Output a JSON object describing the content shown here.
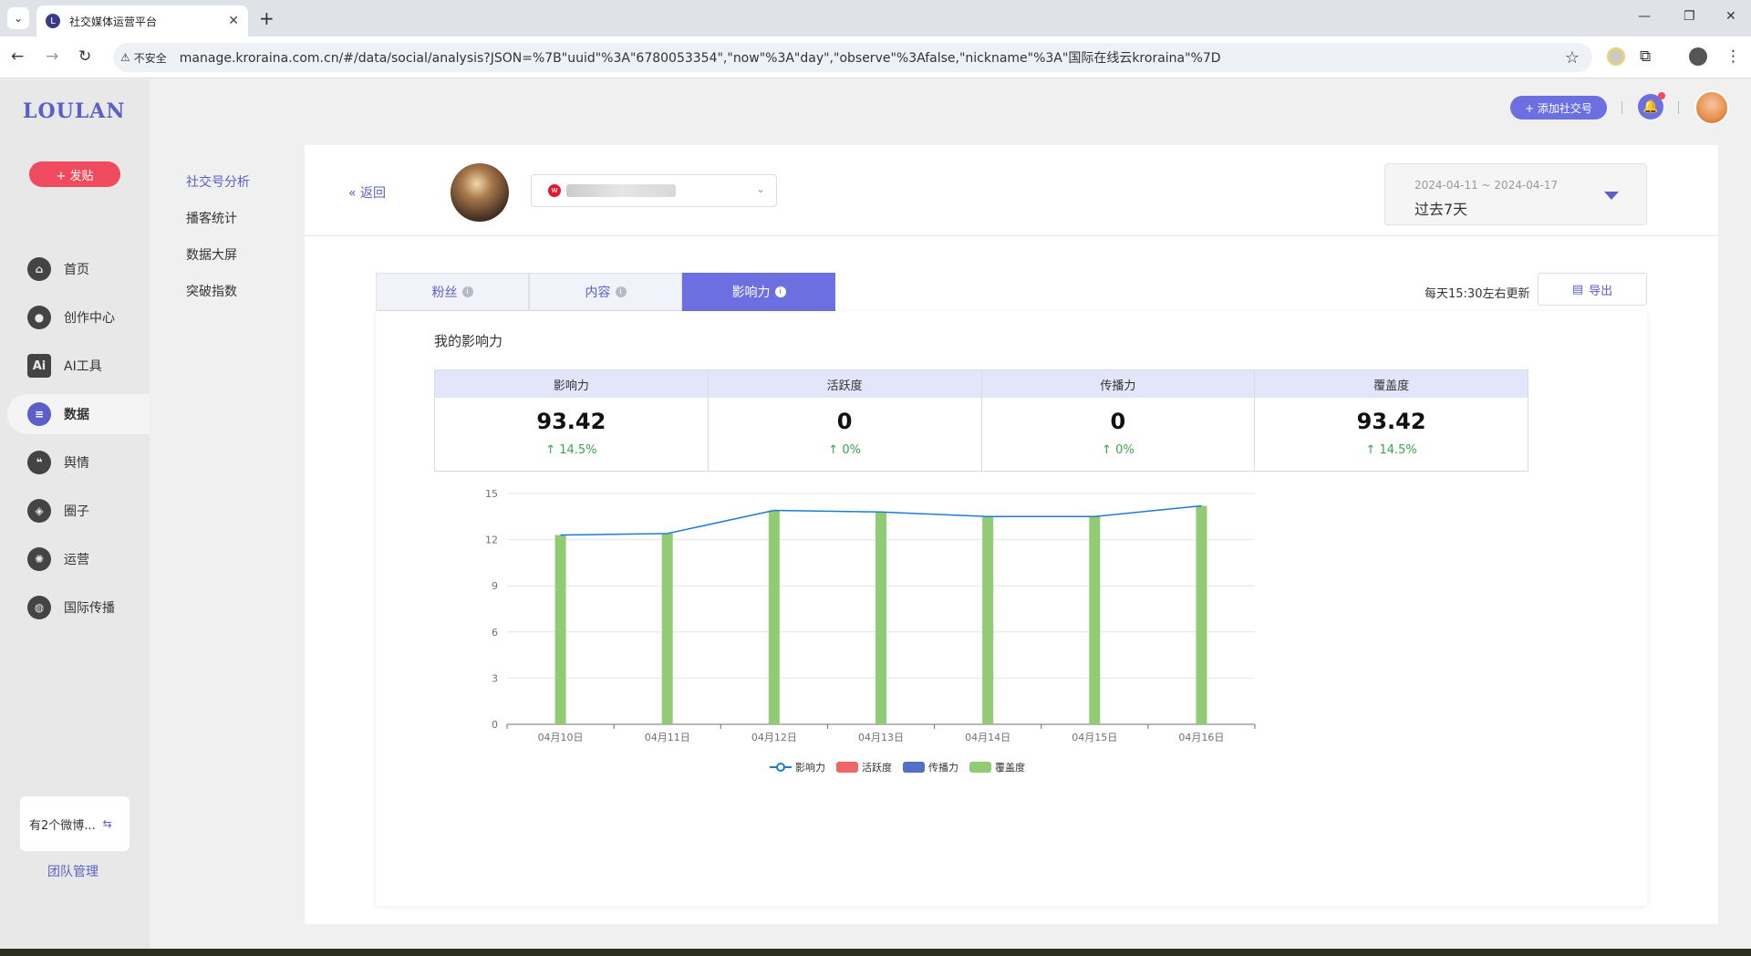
{
  "browser": {
    "tab_title": "社交媒体运营平台",
    "insecure_label": "不安全",
    "url": "manage.kroraina.com.cn/#/data/social/analysis?JSON=%7B\"uuid\"%3A\"6780053354\",\"now\"%3A\"day\",\"observe\"%3Afalse,\"nickname\"%3A\"国际在线云kroraina\"%7D"
  },
  "sidebar": {
    "logo": "LOULAN",
    "post_button": "+ 发贴",
    "items": [
      {
        "label": "首页",
        "icon": "home-icon"
      },
      {
        "label": "创作中心",
        "icon": "palette-icon"
      },
      {
        "label": "AI工具",
        "icon": "ai-icon"
      },
      {
        "label": "数据",
        "icon": "database-icon"
      },
      {
        "label": "舆情",
        "icon": "quote-icon"
      },
      {
        "label": "圈子",
        "icon": "compass-icon"
      },
      {
        "label": "运营",
        "icon": "network-icon"
      },
      {
        "label": "国际传播",
        "icon": "globe-icon"
      }
    ],
    "active_index": 3,
    "weibo_note": "有2个微博...",
    "team_link": "团队管理"
  },
  "subnav": {
    "items": [
      "社交号分析",
      "播客统计",
      "数据大屏",
      "突破指数"
    ],
    "active_index": 0
  },
  "topbar": {
    "add_social_label": "+ 添加社交号"
  },
  "header": {
    "back_label": "« 返回",
    "date_range": "2024-04-11 ~ 2024-04-17",
    "date_label": "过去7天"
  },
  "tabs": [
    {
      "label": "粉丝"
    },
    {
      "label": "内容"
    },
    {
      "label": "影响力"
    }
  ],
  "active_tab": 2,
  "update_text": "每天15:30左右更新",
  "export_label": "导出",
  "card_title": "我的影响力",
  "metrics": [
    {
      "label": "影响力",
      "value": "93.42",
      "change": "↑ 14.5%"
    },
    {
      "label": "活跃度",
      "value": "0",
      "change": "↑ 0%"
    },
    {
      "label": "传播力",
      "value": "0",
      "change": "↑ 0%"
    },
    {
      "label": "覆盖度",
      "value": "93.42",
      "change": "↑ 14.5%"
    }
  ],
  "colors": {
    "accent": "#6c6fe0",
    "line": "#1f7bd1",
    "bar": "#91cc75",
    "red": "#ee6666",
    "blue": "#5470c6",
    "green_change": "#3ca44a"
  },
  "chart_data": {
    "type": "bar",
    "categories": [
      "04月10日",
      "04月11日",
      "04月12日",
      "04月13日",
      "04月14日",
      "04月15日",
      "04月16日"
    ],
    "ylim": [
      0,
      15
    ],
    "yticks": [
      0,
      3,
      6,
      9,
      12,
      15
    ],
    "series": [
      {
        "name": "影响力",
        "type": "line",
        "values": [
          12.3,
          12.4,
          13.9,
          13.8,
          13.5,
          13.5,
          14.2
        ]
      },
      {
        "name": "活跃度",
        "type": "bar",
        "values": [
          0,
          0,
          0,
          0,
          0,
          0,
          0
        ]
      },
      {
        "name": "传播力",
        "type": "bar",
        "values": [
          0,
          0,
          0,
          0,
          0,
          0,
          0
        ]
      },
      {
        "name": "覆盖度",
        "type": "bar",
        "values": [
          12.3,
          12.4,
          13.9,
          13.8,
          13.5,
          13.5,
          14.2
        ]
      }
    ],
    "legend_position": "bottom"
  }
}
